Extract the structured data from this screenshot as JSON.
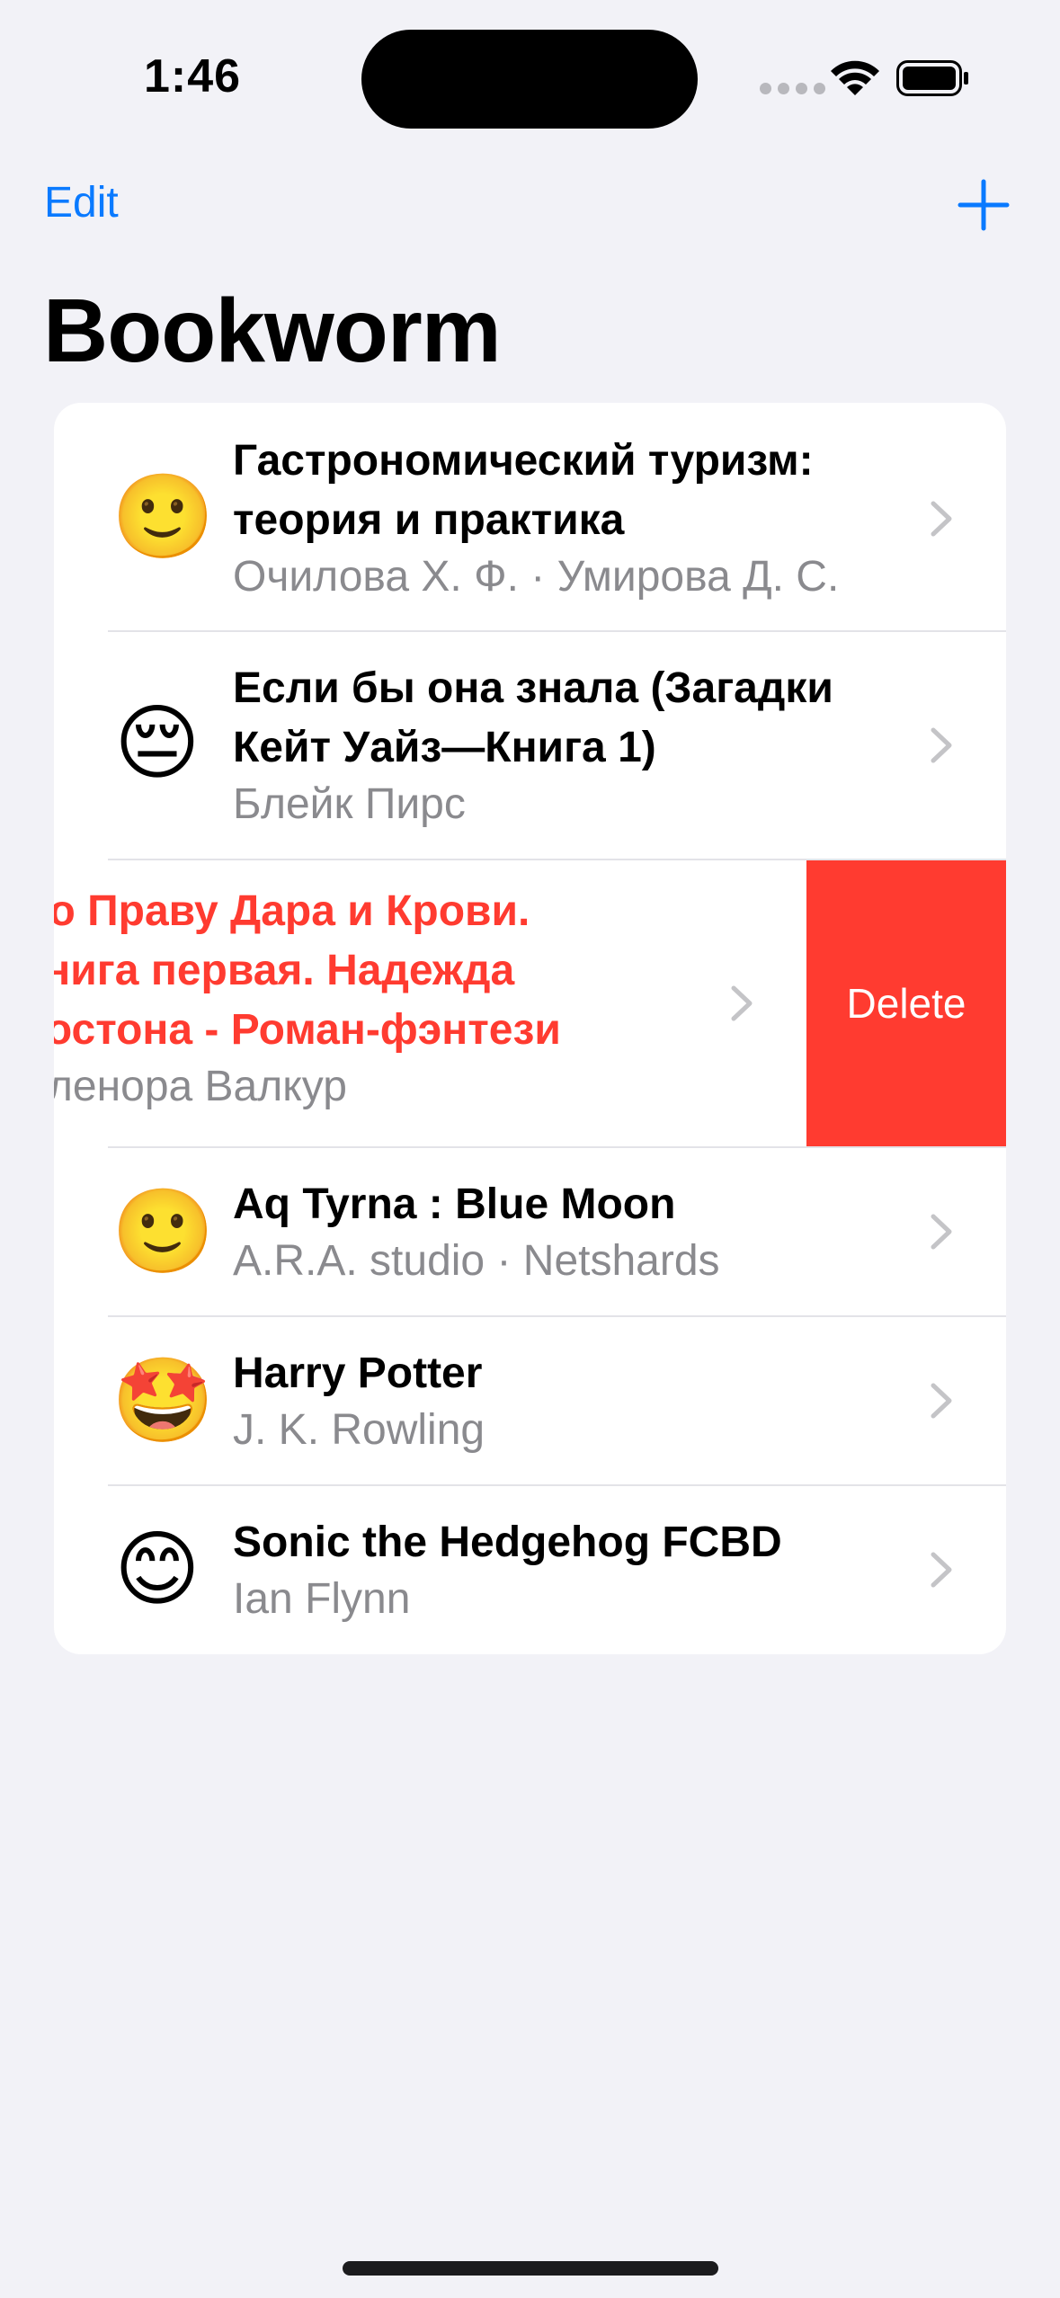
{
  "status_bar": {
    "time": "1:46"
  },
  "nav": {
    "edit_label": "Edit",
    "add_icon": "plus-icon"
  },
  "title": "Bookworm",
  "books": [
    {
      "emoji": "🙂",
      "title_lines": [
        "Гастрономический туризм:",
        "теория и практика"
      ],
      "author": "Очилова Х. Ф. · Умирова Д. С."
    },
    {
      "emoji": "😔",
      "title_lines": [
        "Если бы она знала (Загадки",
        "Кейт Уайз—Книга 1)"
      ],
      "author": "Блейк Пирс"
    },
    {
      "emoji": "",
      "title_lines": [
        "По Праву Дара и Крови.",
        "Книга первая. Надежда",
        "Ростона - Роман-фэнтези"
      ],
      "author": "Эленора Валкур",
      "delete_label": "Delete"
    },
    {
      "emoji": "🙂",
      "title_lines": [
        "Aq Tyrna : Blue Moon"
      ],
      "author": "A.R.A. studio · Netshards"
    },
    {
      "emoji": "🤩",
      "title_lines": [
        "Harry Potter"
      ],
      "author": "J. K. Rowling"
    },
    {
      "emoji": "😊",
      "title_lines": [
        "Sonic the Hedgehog FCBD"
      ],
      "author": "Ian Flynn"
    }
  ],
  "colors": {
    "accent": "#0A7AFF",
    "destructive": "#FF3B30",
    "background": "#F2F2F7",
    "secondary_text": "#8A8A8E"
  }
}
